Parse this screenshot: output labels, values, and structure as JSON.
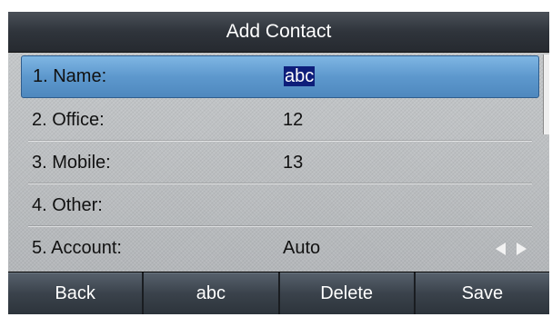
{
  "title": "Add Contact",
  "fields": [
    {
      "label": "1. Name:",
      "value": "abc"
    },
    {
      "label": "2. Office:",
      "value": "12"
    },
    {
      "label": "3. Mobile:",
      "value": "13"
    },
    {
      "label": "4. Other:",
      "value": ""
    },
    {
      "label": "5. Account:",
      "value": "Auto"
    }
  ],
  "softkeys": {
    "back": "Back",
    "input_mode": "abc",
    "delete": "Delete",
    "save": "Save"
  },
  "colors": {
    "selection": "#5d98cd",
    "text_highlight": "#0e1e7a"
  }
}
